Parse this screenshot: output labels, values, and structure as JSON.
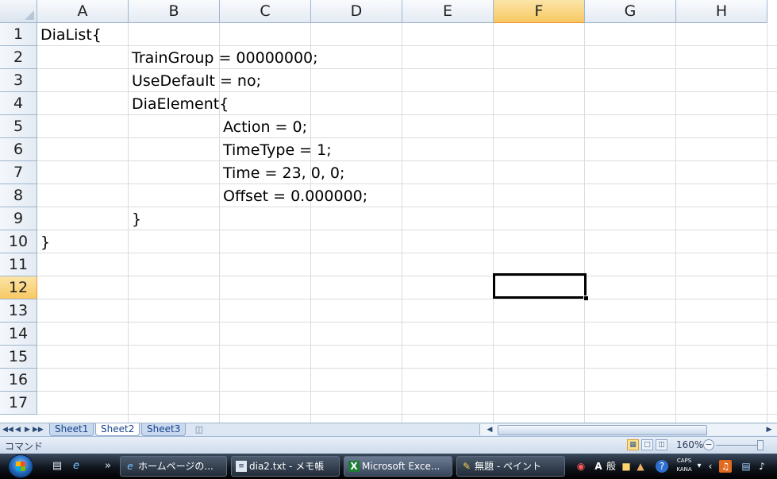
{
  "columns": [
    "A",
    "B",
    "C",
    "D",
    "E",
    "F",
    "G",
    "H"
  ],
  "selected_column": "F",
  "rows": [
    "1",
    "2",
    "3",
    "4",
    "5",
    "6",
    "7",
    "8",
    "9",
    "10",
    "11",
    "12",
    "13",
    "14",
    "15",
    "16",
    "17"
  ],
  "selected_row": "12",
  "cells": {
    "A1": "DiaList{",
    "B2": "TrainGroup = 00000000;",
    "B3": "UseDefault = no;",
    "B4": "DiaElement{",
    "C5": "Action = 0;",
    "C6": "TimeType = 1;",
    "C7": "Time = 23, 0, 0;",
    "C8": "Offset = 0.000000;",
    "B9": "}",
    "A10": "}"
  },
  "sheets": [
    "Sheet1",
    "Sheet2",
    "Sheet3"
  ],
  "active_sheet": "Sheet2",
  "status": {
    "mode": "コマンド",
    "zoom": "160%"
  },
  "taskbar": {
    "buttons": [
      {
        "label": "ホームページの...",
        "icon": "ie-icon"
      },
      {
        "label": "dia2.txt - メモ帳",
        "icon": "notepad-icon"
      },
      {
        "label": "Microsoft Exce...",
        "icon": "excel-icon"
      },
      {
        "label": "無題 - ペイント",
        "icon": "paint-icon"
      }
    ],
    "ime_mode": "A",
    "ime_label": "般",
    "caps": "CAPS",
    "kana": "KANA"
  }
}
